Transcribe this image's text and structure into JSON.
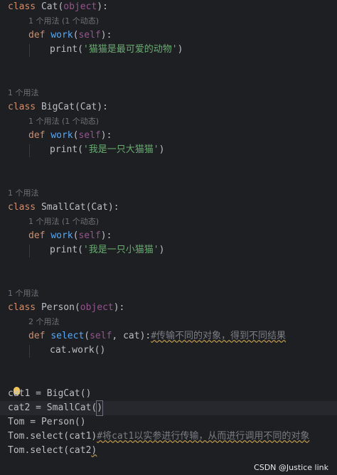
{
  "code": {
    "cat_class": "Cat",
    "cat_base": "object",
    "cat_usage": "1 个用法 (1 个动态)",
    "cat_print_str": "'猫猫是最可爱的动物'",
    "bigcat_usage_top": "1 个用法",
    "bigcat_class": "BigCat",
    "bigcat_base": "Cat",
    "bigcat_usage": "1 个用法 (1 个动态)",
    "bigcat_print_str": "'我是一只大猫猫'",
    "smallcat_usage_top": "1 个用法",
    "smallcat_class": "SmallCat",
    "smallcat_base": "Cat",
    "smallcat_usage": "1 个用法 (1 个动态)",
    "smallcat_print_str": "'我是一只小猫猫'",
    "person_usage_top": "1 个用法",
    "person_class": "Person",
    "person_base": "object",
    "select_usage": "2 个用法",
    "select_name": "select",
    "select_param": "cat",
    "select_comment": "#传输不同的对象，得到不同结果",
    "select_body": "cat.work()",
    "stmt_cat1": "cat1 = BigCat()",
    "stmt_cat2_prefix": "cat2 = SmallCat(",
    "stmt_cat2_suffix": ")",
    "stmt_tom": "Tom = Person()",
    "stmt_select1": "Tom.select(cat1)",
    "stmt_select1_comment": "#将cat1以实参进行传输，从而进行调用不同的对象",
    "stmt_select2_prefix": "Tom.select(cat2",
    "stmt_select2_suffix": ")"
  },
  "keywords": {
    "class": "class",
    "def": "def",
    "self": "self",
    "work": "work",
    "print": "print"
  },
  "watermark": "CSDN @Justice link"
}
